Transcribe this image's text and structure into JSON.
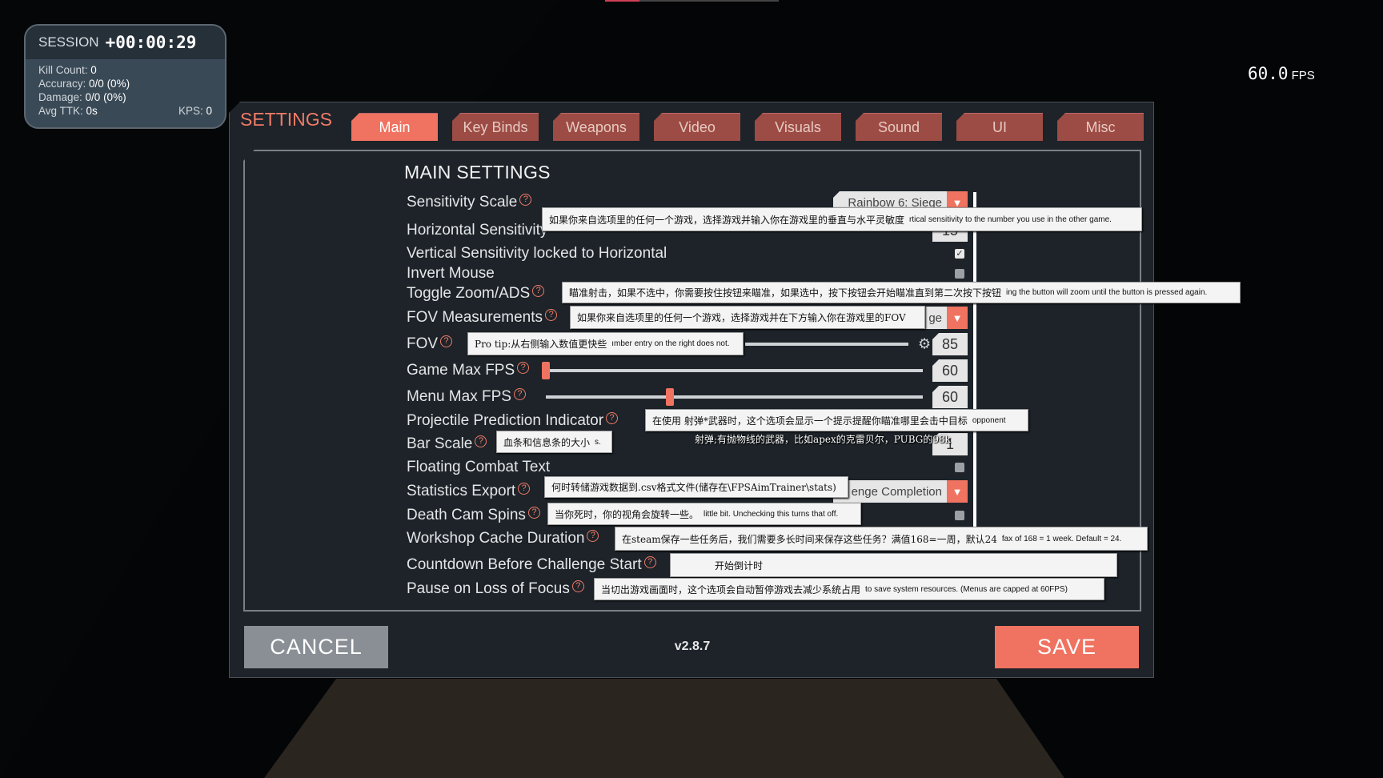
{
  "hud": {
    "session_label": "SESSION",
    "session_time": "+00:00:29",
    "kill_count_label": "Kill Count:",
    "kill_count": "0",
    "accuracy_label": "Accuracy:",
    "accuracy": "0/0 (0%)",
    "damage_label": "Damage:",
    "damage": "0/0 (0%)",
    "avg_ttk_label": "Avg TTK:",
    "avg_ttk": "0s",
    "kps_label": "KPS:",
    "kps": "0",
    "fps_value": "60.0",
    "fps_label": "FPS"
  },
  "settings": {
    "title": "SETTINGS",
    "tabs": [
      {
        "label": "Main",
        "active": true
      },
      {
        "label": "Key Binds"
      },
      {
        "label": "Weapons"
      },
      {
        "label": "Video"
      },
      {
        "label": "Visuals"
      },
      {
        "label": "Sound"
      },
      {
        "label": "UI"
      },
      {
        "label": "Misc"
      }
    ],
    "heading": "MAIN SETTINGS",
    "rows": [
      {
        "label": "Sensitivity Scale",
        "help": true,
        "control": "dropdown",
        "value": "Rainbow 6: Siege"
      },
      {
        "label": "Horizontal Sensitivity",
        "help": false,
        "control": "number",
        "value": "15"
      },
      {
        "label": "Vertical Sensitivity locked to Horizontal",
        "help": false,
        "control": "checkbox",
        "checked": true
      },
      {
        "label": "Invert Mouse",
        "help": false,
        "control": "checkbox",
        "checked": false
      },
      {
        "label": "Toggle Zoom/ADS",
        "help": true,
        "control": "none"
      },
      {
        "label": "FOV Measurements",
        "help": true,
        "control": "dropdown",
        "value": "ge"
      },
      {
        "label": "FOV",
        "help": true,
        "control": "slider-gear",
        "value": "85"
      },
      {
        "label": "Game Max FPS",
        "help": true,
        "control": "slider",
        "value": "60",
        "slider_fraction": 0.0
      },
      {
        "label": "Menu Max FPS",
        "help": true,
        "control": "slider",
        "value": "60",
        "slider_fraction": 0.33
      },
      {
        "label": "Projectile Prediction Indicator",
        "help": true,
        "control": "none"
      },
      {
        "label": "Bar Scale",
        "help": true,
        "control": "number",
        "value": "1"
      },
      {
        "label": "Floating Combat Text",
        "help": false,
        "control": "checkbox",
        "checked": false
      },
      {
        "label": "Statistics Export",
        "help": true,
        "control": "dropdown",
        "value": "enge Completion"
      },
      {
        "label": "Death Cam Spins",
        "help": true,
        "control": "checkbox",
        "checked": false
      },
      {
        "label": "Workshop Cache Duration",
        "help": true,
        "control": "none"
      },
      {
        "label": "Countdown Before Challenge Start",
        "help": true,
        "control": "none"
      },
      {
        "label": "Pause on Loss of Focus",
        "help": true,
        "control": "none"
      }
    ],
    "tooltips": [
      {
        "zh": "如果你来自选项里的任何一个游戏，选择游戏并输入你在游戏里的垂直与水平灵敏度",
        "en": "rtical sensitivity to the number you use in the other game."
      },
      {
        "zh": "瞄准射击，如果不选中，你需要按住按钮来瞄准，如果选中，按下按钮会开始瞄准直到第二次按下按钮",
        "en": "ing the button will zoom until the button is pressed again."
      },
      {
        "zh": "如果你来自选项里的任何一个游戏，选择游戏并在下方输入你在游戏里的FOV",
        "en": ""
      },
      {
        "zh": "Pro tip:从右侧输入数值更快些",
        "en": "ımber entry on the right does not."
      },
      {
        "zh": "在使用 射弹*武器时，这个选项会显示一个提示提醒你瞄准哪里会击中目标",
        "en": "opponent"
      },
      {
        "zh": "血条和信息条的大小",
        "en": "s."
      },
      {
        "zh": "何时转储游戏数据到.csv格式文件(储存在\\FPSAimTrainer\\stats)",
        "en": ""
      },
      {
        "zh": "当你死时，你的视角会旋转一些。",
        "en": "little bit.  Unchecking this turns that off."
      },
      {
        "zh": "在steam保存一些任务后，我们需要多长时间来保存这些任务？满值168=一周，默认24",
        "en": "fax of 168 = 1 week.  Default = 24."
      },
      {
        "zh": "开始倒计时",
        "en": ""
      },
      {
        "zh": "当切出游戏画面时，这个选项会自动暂停游戏去减少系统占用",
        "en": "to save system resources.  (Menus are capped at 60FPS)"
      }
    ],
    "subtitle_note": "射弹;有抛物线的武器，比如apex的克雷贝尔，PUBG的98k",
    "cancel_label": "CANCEL",
    "version": "v2.8.7",
    "save_label": "SAVE"
  },
  "colors": {
    "accent": "#ef7360",
    "tab_inactive": "#9c4c44",
    "panel": "#1d2329"
  }
}
